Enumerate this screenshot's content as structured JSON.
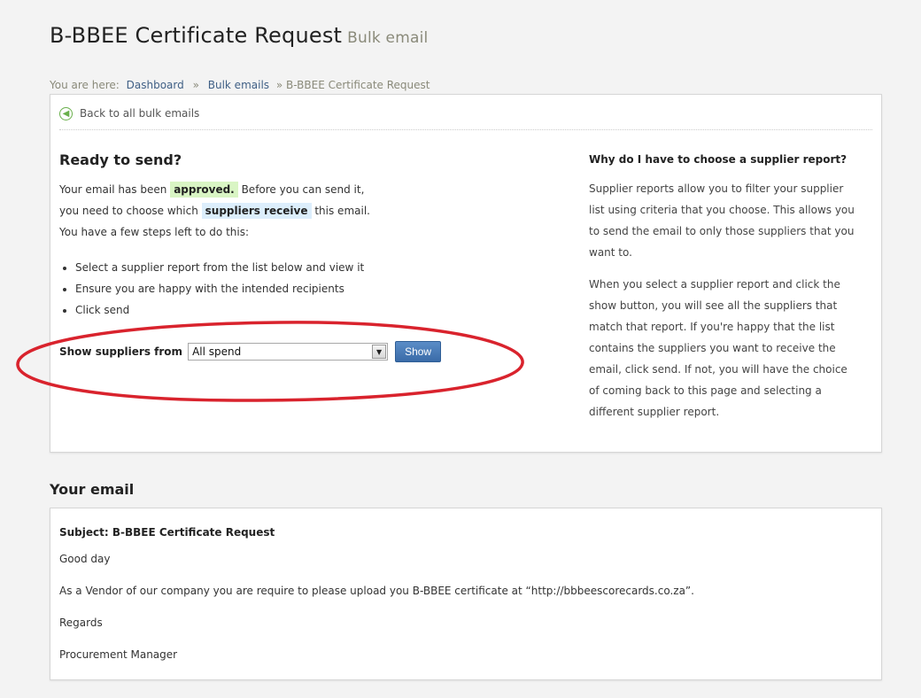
{
  "page": {
    "title": "B-BBEE Certificate Request",
    "subtitle": "Bulk email"
  },
  "breadcrumb": {
    "prefix": "You are here:",
    "items": [
      "Dashboard",
      "Bulk emails"
    ],
    "current": "» B-BBEE Certificate Request"
  },
  "back": {
    "label": "Back to all bulk emails"
  },
  "ready": {
    "title": "Ready to send?",
    "line1_a": "Your email has been",
    "line1_hl": "approved.",
    "line1_b": "Before you can send it,",
    "line2_a": "you need to choose which",
    "line2_hl": "suppliers receive",
    "line2_b": "this email.",
    "line3": "You have a few steps left to do this:",
    "steps": [
      "Select a supplier report from the list below and view it",
      "Ensure you are happy with the intended recipients",
      "Click send"
    ]
  },
  "filter": {
    "label": "Show suppliers from",
    "selected": "All spend",
    "button": "Show"
  },
  "help": {
    "title": "Why do I have to choose a supplier report?",
    "para1": "Supplier reports allow you to filter your supplier list using criteria that you choose. This allows you to send the email to only those suppliers that you want to.",
    "para2": "When you select a supplier report and click the show button, you will see all the suppliers that match that report. If you're happy that the list contains the suppliers you want to receive the email, click send. If not, you will have the choice of coming back to this page and selecting a different supplier report."
  },
  "email": {
    "heading": "Your email",
    "subject": "Subject: B-BBEE Certificate Request",
    "greeting": "Good day",
    "body": "As a Vendor of our company you are require to please upload you B-BBEE certificate at “http://bbbeescorecards.co.za”.",
    "signoff": "Regards",
    "signature": "Procurement Manager"
  },
  "colors": {
    "highlight_ellipse": "#d9232d",
    "approved_bg": "#d9f5c4",
    "suppliers_bg": "#dceefc",
    "button_bg": "#3f72b0"
  }
}
